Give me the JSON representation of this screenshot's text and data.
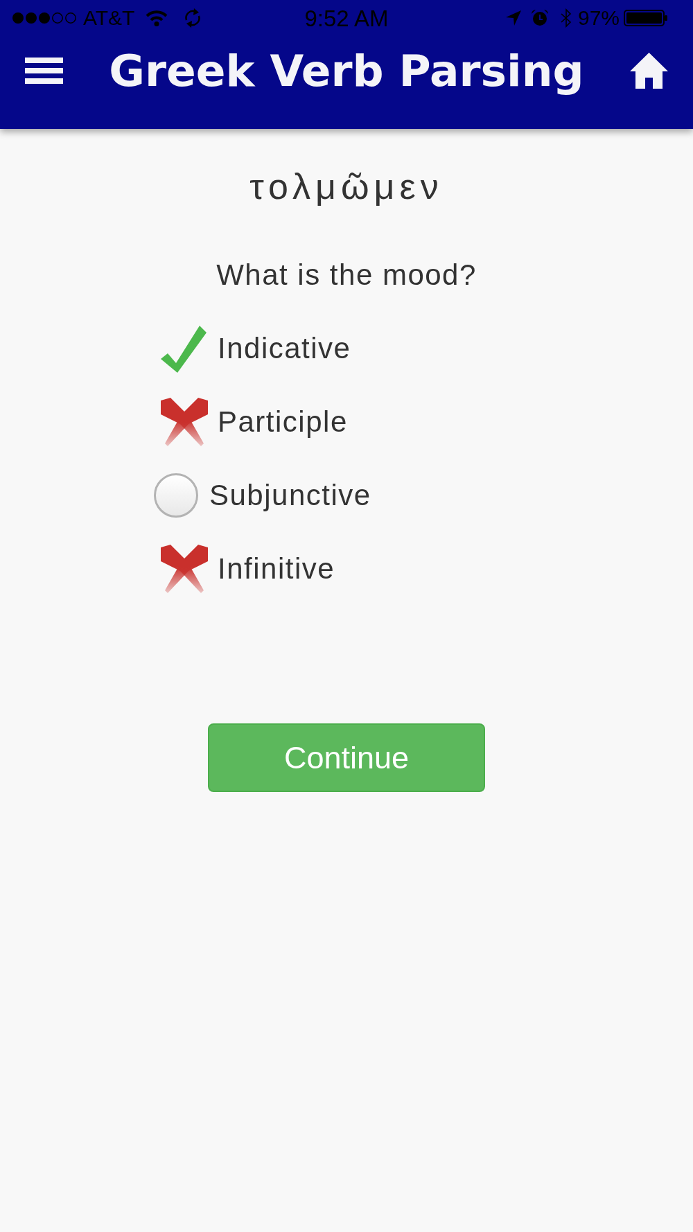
{
  "status_bar": {
    "carrier": "AT&T",
    "time": "9:52 AM",
    "battery": "97%"
  },
  "header": {
    "title": "Greek Verb Parsing"
  },
  "word": "τολμῶμεν",
  "question": "What is the mood?",
  "options": [
    {
      "label": "Indicative",
      "kind": "correct",
      "selected": false
    },
    {
      "label": "Participle",
      "kind": "incorrect",
      "selected": false
    },
    {
      "label": "Subjunctive",
      "kind": "choice",
      "selected": false
    },
    {
      "label": "Infinitive",
      "kind": "incorrect",
      "selected": false
    }
  ],
  "button": "Continue"
}
